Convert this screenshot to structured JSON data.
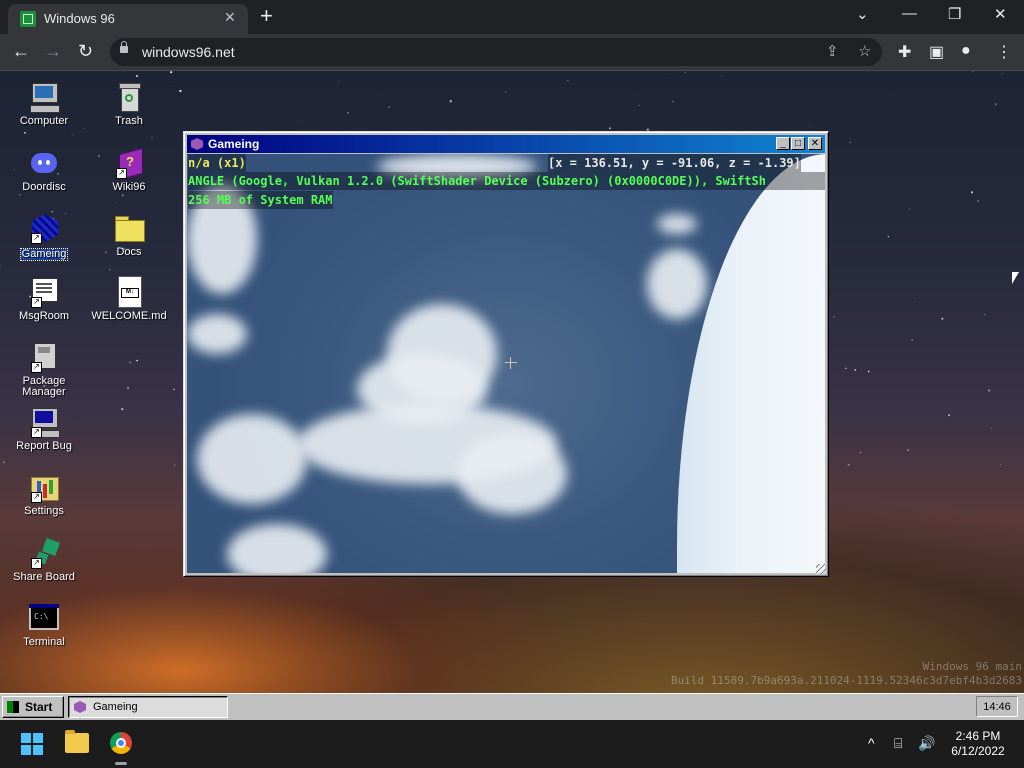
{
  "browser": {
    "tab_title": "Windows 96",
    "url": "windows96.net",
    "icons": {
      "new_tab": "+",
      "close_tab": "✕",
      "back": "←",
      "forward": "→",
      "reload": "↻",
      "share": "⇪",
      "bookmark": "☆",
      "extensions": "✚",
      "sidepanel": "▣",
      "profile": "●",
      "menu": "⋮",
      "tab_search": "⌄",
      "minimize": "—",
      "restore": "❐",
      "close": "✕"
    }
  },
  "desktop": {
    "icons": [
      {
        "label": "Computer"
      },
      {
        "label": "Trash"
      },
      {
        "label": "Doordisc"
      },
      {
        "label": "Wiki96"
      },
      {
        "label": "Gameing"
      },
      {
        "label": "Docs"
      },
      {
        "label": "MsgRoom"
      },
      {
        "label": "WELCOME.md"
      },
      {
        "label": "Package Manager"
      },
      {
        "label": "Report Bug"
      },
      {
        "label": "Settings"
      },
      {
        "label": "Share Board"
      },
      {
        "label": "Terminal"
      }
    ],
    "watermark": {
      "line1": "Windows 96 main",
      "line2": "Build 11589.7b9a693a.211024-1119.52346c3d7ebf4b3d2683"
    }
  },
  "game_window": {
    "title": "Gameing",
    "btn_min": "_",
    "btn_max": "□",
    "btn_close": "✕",
    "hud": {
      "mode": "n/a (x1)",
      "coords": "[x = 136.51, y = -91.06, z = -1.39]",
      "renderer": "ANGLE (Google, Vulkan 1.2.0 (SwiftShader Device (Subzero) (0x0000C0DE)), SwiftSh",
      "ram": "256 MB of System RAM"
    },
    "hud_colors": {
      "mode": "#e8e85a",
      "coords": "#e8e8e8",
      "renderer": "#55ff55",
      "ram": "#55ff55"
    }
  },
  "w96_taskbar": {
    "start_label": "Start",
    "task_label": "Gameing",
    "clock": "14:46"
  },
  "win_taskbar": {
    "time": "2:46 PM",
    "date": "6/12/2022",
    "tray": {
      "chevron": "^",
      "network": "⌸",
      "volume": "🔊"
    }
  }
}
